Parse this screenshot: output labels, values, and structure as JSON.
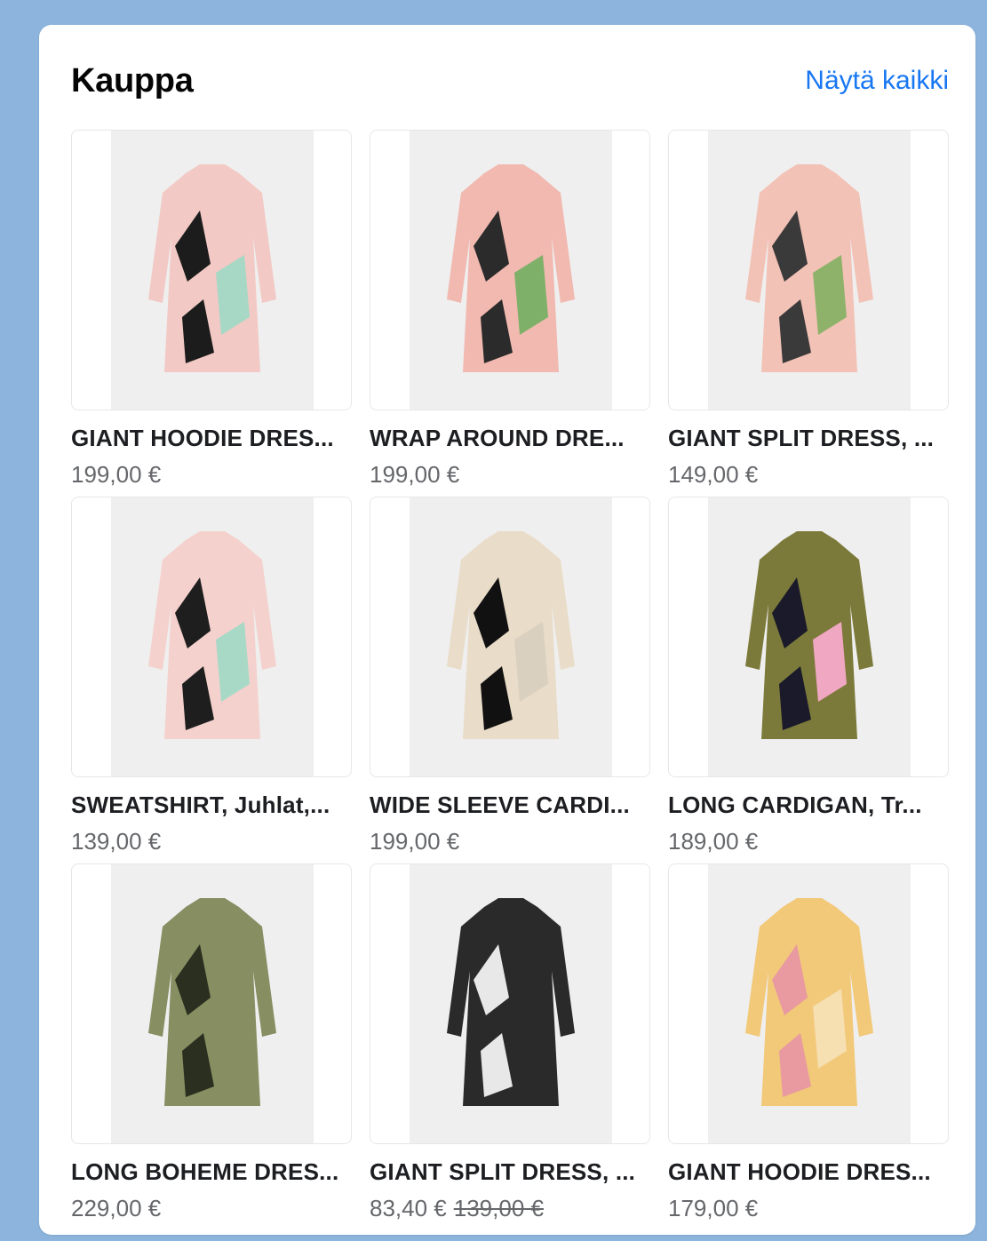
{
  "shop": {
    "title": "Kauppa",
    "see_all": "Näytä kaikki"
  },
  "products": [
    {
      "name": "GIANT HOODIE DRES...",
      "price": "199,00 €",
      "old_price": "",
      "icon": "hoodie-dress-image",
      "colors": [
        "#f2c9c4",
        "#1c1c1c",
        "#a7d8c6"
      ]
    },
    {
      "name": "WRAP AROUND DRE...",
      "price": "199,00 €",
      "old_price": "",
      "icon": "wrap-dress-image",
      "colors": [
        "#f1b9b0",
        "#2b2b2b",
        "#7fb069"
      ]
    },
    {
      "name": "GIANT SPLIT DRESS, ...",
      "price": "149,00 €",
      "old_price": "",
      "icon": "split-dress-image",
      "colors": [
        "#f3c2b6",
        "#3a3a3a",
        "#8fb26b"
      ]
    },
    {
      "name": "SWEATSHIRT, Juhlat,...",
      "price": "139,00 €",
      "old_price": "",
      "icon": "sweatshirt-image",
      "colors": [
        "#f4d1cc",
        "#1e1e1e",
        "#a8d9c7"
      ]
    },
    {
      "name": "WIDE SLEEVE CARDI...",
      "price": "199,00 €",
      "old_price": "",
      "icon": "wide-sleeve-cardigan-image",
      "colors": [
        "#e9dcc8",
        "#111111",
        "#d9d0c0"
      ]
    },
    {
      "name": "LONG CARDIGAN, Tr...",
      "price": "189,00 €",
      "old_price": "",
      "icon": "long-cardigan-image",
      "colors": [
        "#7c7a3a",
        "#1a1a2a",
        "#f0a7c2"
      ]
    },
    {
      "name": "LONG BOHEME DRES...",
      "price": "229,00 €",
      "old_price": "",
      "icon": "boheme-dress-image",
      "colors": [
        "#868e62",
        "#2b2f20",
        "#868e62"
      ]
    },
    {
      "name": "GIANT SPLIT DRESS, ...",
      "price": "83,40 €",
      "old_price": "139,00 €",
      "icon": "dotted-split-dress-image",
      "colors": [
        "#2a2a2a",
        "#e8e8e8",
        "#2a2a2a"
      ]
    },
    {
      "name": "GIANT HOODIE DRES...",
      "price": "179,00 €",
      "old_price": "",
      "icon": "yellow-hoodie-dress-image",
      "colors": [
        "#f2c879",
        "#e89aa0",
        "#f6dfb0"
      ]
    }
  ]
}
